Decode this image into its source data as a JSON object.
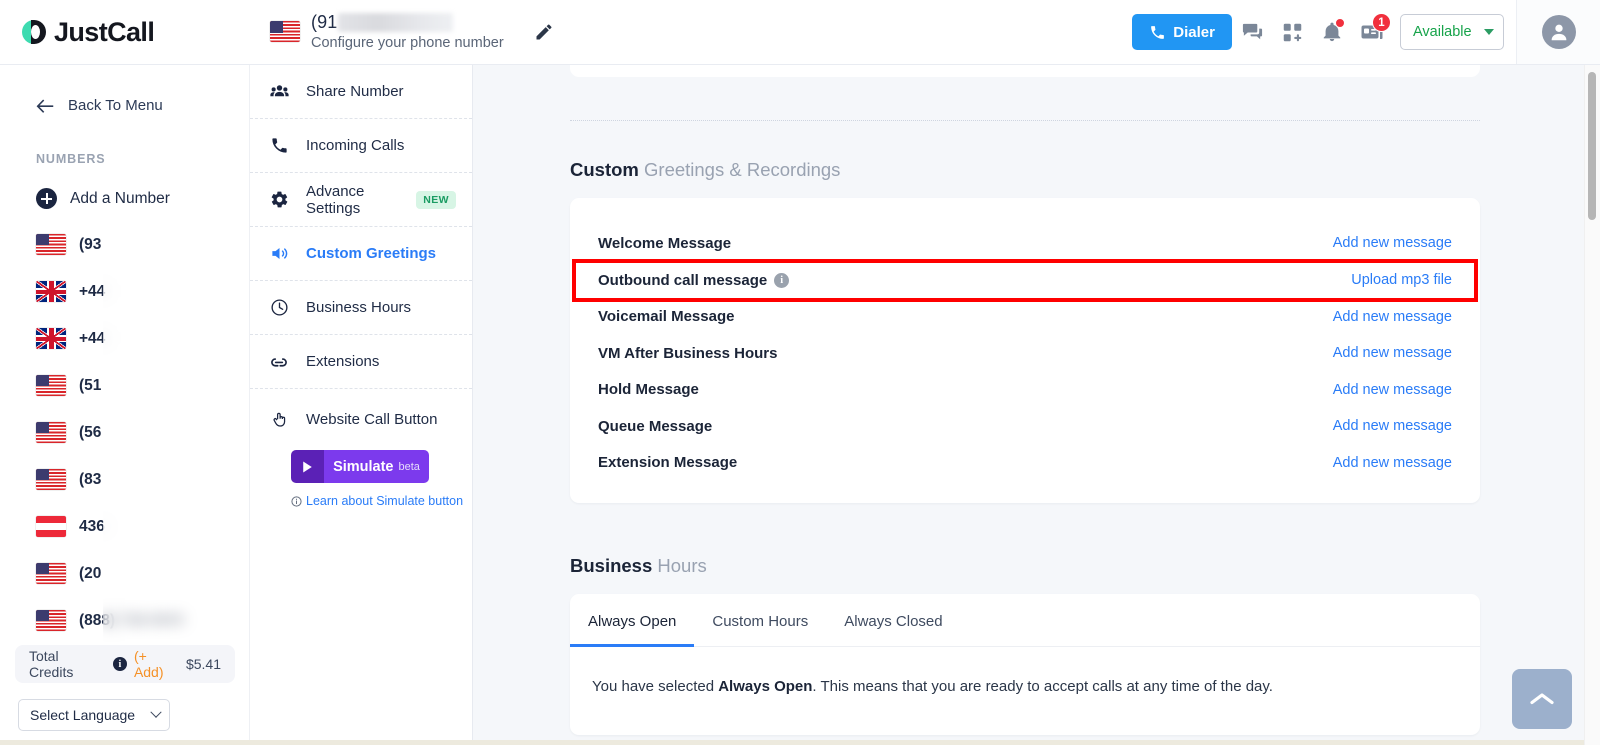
{
  "brand": {
    "name": "JustCall"
  },
  "header": {
    "number_prefix": "(91",
    "number_masked": true,
    "subtitle": "Configure your phone number",
    "edit_title": "Edit phone number",
    "dialer_label": "Dialer",
    "notification_count": "1",
    "status": "Available",
    "status_color": "#16a34a"
  },
  "sidebar": {
    "back_label": "Back To Menu",
    "section_title": "NUMBERS",
    "add_number_label": "Add a Number",
    "numbers": [
      {
        "flag": "us",
        "label": "(93"
      },
      {
        "flag": "uk",
        "label": "+44"
      },
      {
        "flag": "uk",
        "label": "+44"
      },
      {
        "flag": "us",
        "label": "(51"
      },
      {
        "flag": "us",
        "label": "(56"
      },
      {
        "flag": "us",
        "label": "(83"
      },
      {
        "flag": "at",
        "label": "436"
      },
      {
        "flag": "us",
        "label": "(20"
      },
      {
        "flag": "us",
        "label": "(888) 718-0605"
      }
    ],
    "credits_label": "Total Credits",
    "credits_add": "(+ Add)",
    "credits_amount": "$5.41",
    "language_placeholder": "Select Language"
  },
  "nav": {
    "items": [
      {
        "label": "Share Number",
        "icon": "people-icon",
        "active": false,
        "badge": ""
      },
      {
        "label": "Incoming Calls",
        "icon": "phone-icon",
        "active": false,
        "badge": ""
      },
      {
        "label": "Advance Settings",
        "icon": "gear-icon",
        "active": false,
        "badge": "NEW"
      },
      {
        "label": "Custom Greetings",
        "icon": "speaker-icon",
        "active": true,
        "badge": ""
      },
      {
        "label": "Business Hours",
        "icon": "clock-icon",
        "active": false,
        "badge": ""
      },
      {
        "label": "Extensions",
        "icon": "link-icon",
        "active": false,
        "badge": ""
      }
    ],
    "website_call_button": {
      "title": "Website Call Button",
      "simulate_label": "Simulate",
      "simulate_beta": "beta",
      "learn_label": "Learn about Simulate button"
    }
  },
  "main": {
    "greetings": {
      "heading_bold": "Custom",
      "heading_rest": " Greetings & Recordings",
      "rows": [
        {
          "name": "Welcome Message",
          "info": false,
          "action": "Add new message",
          "highlight": false
        },
        {
          "name": "Outbound call message",
          "info": true,
          "action": "Upload mp3 file",
          "highlight": true
        },
        {
          "name": "Voicemail Message",
          "info": false,
          "action": "Add new message",
          "highlight": false
        },
        {
          "name": "VM After Business Hours",
          "info": false,
          "action": "Add new message",
          "highlight": false
        },
        {
          "name": "Hold Message",
          "info": false,
          "action": "Add new message",
          "highlight": false
        },
        {
          "name": "Queue Message",
          "info": false,
          "action": "Add new message",
          "highlight": false
        },
        {
          "name": "Extension Message",
          "info": false,
          "action": "Add new message",
          "highlight": false
        }
      ],
      "highlight_color": "#ff0000"
    },
    "business_hours": {
      "heading_bold": "Business",
      "heading_rest": " Hours",
      "tabs": [
        {
          "label": "Always Open",
          "active": true
        },
        {
          "label": "Custom Hours",
          "active": false
        },
        {
          "label": "Always Closed",
          "active": false
        }
      ],
      "description_pre": "You have selected ",
      "description_bold": "Always Open",
      "description_post": ". This means that you are ready to accept calls at any time of the day."
    },
    "scroll_top_label": "Scroll to top"
  }
}
